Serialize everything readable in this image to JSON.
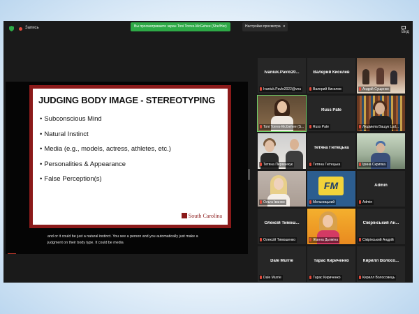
{
  "window": {
    "recording_label": "Запись",
    "share_banner": "Вы просматриваете экран Toni Torres-McGehee (She/Her)",
    "view_options_label": "Настройки просмотра",
    "view_button_label": "Вид"
  },
  "slide": {
    "title": "JUDGING BODY IMAGE - STEREOTYPING",
    "bullets": [
      "Subconscious Mind",
      "Natural Instinct",
      "Media (e.g., models, actress, athletes, etc.)",
      "Personalities & Appearance",
      "False Perception(s)"
    ],
    "logo_text": "South Carolina"
  },
  "caption": {
    "line1": "and or it could be just a natural instinct. You see a person and you automatically just make a",
    "line2": "judgment on their body type. It could be media"
  },
  "participants": [
    {
      "name": "Ivaniuk.Pavlo20...",
      "label": "Ivaniuk.Pavlo2022@vnu",
      "video": "none"
    },
    {
      "name": "Валерий Киселев",
      "label": "Валерий Киселев",
      "video": "none"
    },
    {
      "name": "",
      "label": "Андрій Сущенко",
      "video": "room"
    },
    {
      "name": "",
      "label": "Toni Torres-McGehee (S...",
      "video": "woman1"
    },
    {
      "name": "Russ Pate",
      "label": "Russ Pate",
      "video": "none"
    },
    {
      "name": "",
      "label": "Людмила Ващук Lud...",
      "video": "library"
    },
    {
      "name": "",
      "label": "Тетяна Перванчук",
      "video": "couple"
    },
    {
      "name": "Тетяна Гнітецька",
      "label": "Тетяна Гнітецька",
      "video": "none"
    },
    {
      "name": "",
      "label": "Ірина Скрипка",
      "video": "outdoor"
    },
    {
      "name": "",
      "label": "Ольга Іванюк",
      "video": "blonde"
    },
    {
      "name": "",
      "label": "Мельницький",
      "video": "fm"
    },
    {
      "name": "Admin",
      "label": "Admin",
      "video": "none"
    },
    {
      "name": "Олексій Тимош...",
      "label": "Олексій Тимошенко",
      "video": "none"
    },
    {
      "name": "",
      "label": "Жанна Дьоміна",
      "video": "sunny"
    },
    {
      "name": "Сікірінський Ан...",
      "label": "Сікірінський Андрій",
      "video": "none"
    },
    {
      "name": "Dale Murrie",
      "label": "Dale Murrie",
      "video": "none"
    },
    {
      "name": "Тарас Кириченко",
      "label": "Тарас Кириченко",
      "video": "none"
    },
    {
      "name": "Кирилл Волосо...",
      "label": "Кирилл Волосовець",
      "video": "none"
    }
  ],
  "fm_logo": "FM",
  "colors": {
    "share_banner": "#2eaa47",
    "slide_frame": "#8b1a1a",
    "active_speaker": "#6fd46a",
    "muted_mic": "#e24a3b"
  }
}
